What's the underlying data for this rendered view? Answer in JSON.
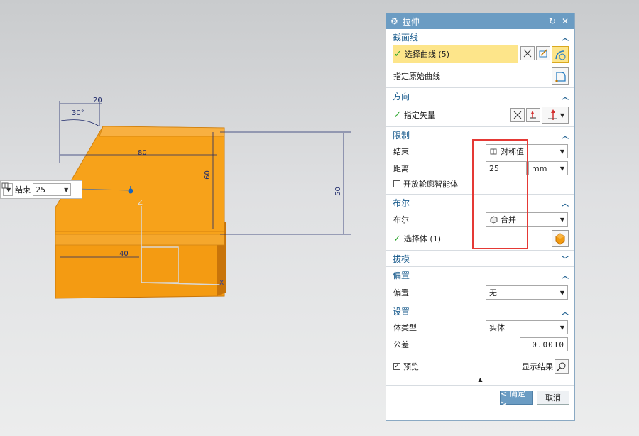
{
  "viewport": {
    "dims": {
      "d1": "20",
      "d2": "30°",
      "d3": "80",
      "d4": "60",
      "d5": "50",
      "d6": "40"
    },
    "axis_z": "Z",
    "axis_x": "X",
    "float_input": {
      "label": "结束",
      "value": "25"
    }
  },
  "dialog": {
    "title": "拉伸",
    "sections": {
      "section_curve": {
        "header": "截面线",
        "select_curve": "选择曲线 (5)",
        "specify_origin": "指定原始曲线"
      },
      "direction": {
        "header": "方向",
        "specify_vector": "指定矢量"
      },
      "limits": {
        "header": "限制",
        "end_label": "结束",
        "end_value": "对称值",
        "distance_label": "距离",
        "distance_value": "25",
        "distance_unit": "mm",
        "open_profile": "开放轮廓智能体"
      },
      "boolean": {
        "header": "布尔",
        "boolean_label": "布尔",
        "boolean_value": "合并",
        "select_body": "选择体 (1)"
      },
      "draft": {
        "header": "拔模"
      },
      "offset": {
        "header": "偏置",
        "offset_label": "偏置",
        "offset_value": "无"
      },
      "settings": {
        "header": "设置",
        "body_type_label": "体类型",
        "body_type_value": "实体",
        "tolerance_label": "公差",
        "tolerance_value": "0.0010"
      }
    },
    "preview_label": "预览",
    "show_result_label": "显示结果",
    "ok_label": "< 确定 >",
    "cancel_label": "取消"
  },
  "colors": {
    "accent": "#6b9cc3",
    "highlight": "#fde58a",
    "solid": "#f29a0f",
    "annotation": "#e53935"
  }
}
